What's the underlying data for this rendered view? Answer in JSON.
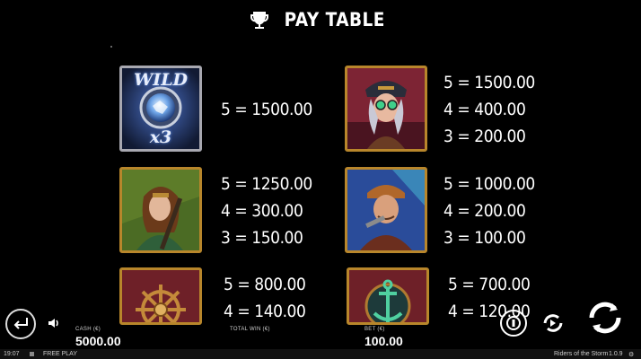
{
  "header": {
    "title": "PAY TABLE"
  },
  "symbols": [
    {
      "name": "wild",
      "wild_text": "WILD",
      "multiplier": "x3",
      "pays": [
        "5 = 1500.00"
      ]
    },
    {
      "name": "captain-woman",
      "pays": [
        "5 = 1500.00",
        "4 = 400.00",
        "3 = 200.00"
      ]
    },
    {
      "name": "rifle-woman",
      "pays": [
        "5 = 1250.00",
        "4 = 300.00",
        "3 = 150.00"
      ]
    },
    {
      "name": "wrench-man",
      "pays": [
        "5 = 1000.00",
        "4 = 200.00",
        "3 = 100.00"
      ]
    },
    {
      "name": "ships-wheel",
      "pays": [
        "5 = 800.00",
        "4 = 140.00"
      ]
    },
    {
      "name": "anchor",
      "pays": [
        "5 = 700.00",
        "4 = 120.00"
      ]
    }
  ],
  "bottom_bar": {
    "cash_label": "CASH (€)",
    "cash_value": "5000.00",
    "total_win_label": "TOTAL WIN (€)",
    "bet_label": "BET (€)",
    "bet_value": "100.00"
  },
  "footer": {
    "time": "19:07",
    "mode": "FREE PLAY",
    "game_name": "Riders of the Storm",
    "version": "1.0.9"
  },
  "colors": {
    "gold_frame": "#b8862b",
    "background": "#000000"
  }
}
